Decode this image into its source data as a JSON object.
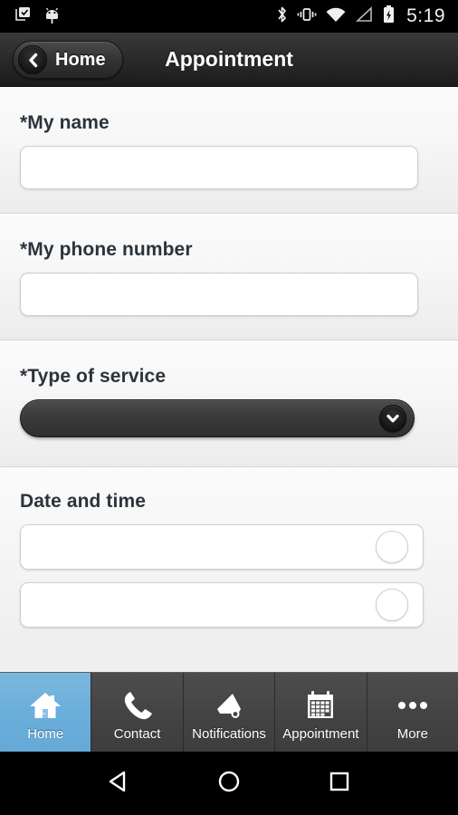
{
  "status_bar": {
    "icons_left": [
      "task-checkbox-icon",
      "android-robot-icon"
    ],
    "icons_right": [
      "bluetooth-icon",
      "vibrate-icon",
      "wifi-icon",
      "cellular-signal-icon",
      "battery-charging-icon"
    ],
    "time": "5:19"
  },
  "app_bar": {
    "back_label": "Home",
    "back_icon": "chevron-left-icon",
    "title": "Appointment"
  },
  "form": {
    "fields": [
      {
        "label": "*My name",
        "value": "",
        "placeholder": "",
        "type": "text"
      },
      {
        "label": "*My phone number",
        "value": "",
        "placeholder": "",
        "type": "text"
      },
      {
        "label": "*Type of service",
        "value": "",
        "placeholder": "",
        "type": "dropdown",
        "dropdown_icon": "chevron-down-icon"
      }
    ],
    "date_time": {
      "label": "Date and time",
      "rows": [
        {
          "value": "",
          "button_icon": "circle-picker-icon"
        },
        {
          "value": "",
          "button_icon": "circle-picker-icon"
        }
      ]
    }
  },
  "tab_bar": {
    "active_index": 0,
    "active_color": "#6aaedb",
    "tabs": [
      {
        "label": "Home",
        "icon": "house-icon"
      },
      {
        "label": "Contact",
        "icon": "phone-icon"
      },
      {
        "label": "Notifications",
        "icon": "megaphone-icon"
      },
      {
        "label": "Appointment",
        "icon": "calendar-icon"
      },
      {
        "label": "More",
        "icon": "ellipsis-icon"
      }
    ]
  },
  "nav_bar": {
    "buttons": [
      {
        "name": "back",
        "icon": "triangle-left-icon"
      },
      {
        "name": "home",
        "icon": "circle-icon"
      },
      {
        "name": "recents",
        "icon": "square-icon"
      }
    ]
  }
}
